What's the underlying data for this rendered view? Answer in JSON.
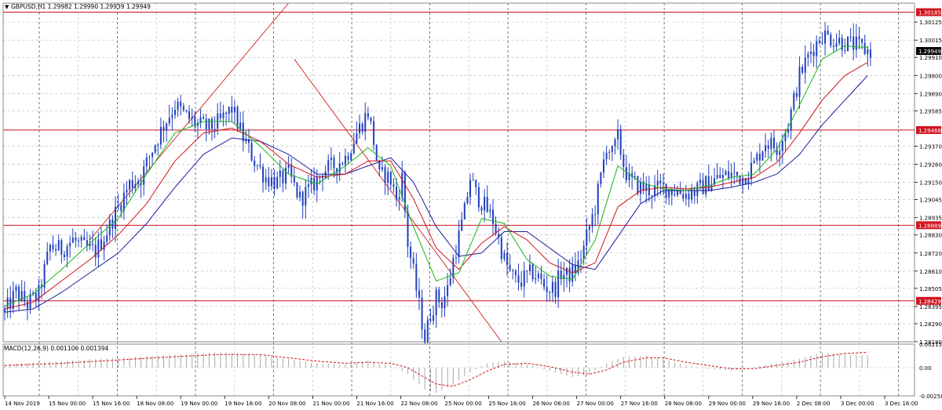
{
  "header": {
    "symbol_line": "GBPUSD,H1  1.29982 1.29990 1.29939 1.29949",
    "macd_label": "MACD(12,26,9) 0.001106 0.001394"
  },
  "colors": {
    "candle": "#1f3fbf",
    "ma_fast": "#17b817",
    "ma_mid": "#d0141e",
    "ma_slow": "#1c1c9c",
    "level_line": "#c8141e",
    "trend_line": "#d01c1c",
    "grid": "#b8b8b8",
    "macd_hist": "#a8a8a8",
    "macd_signal": "#d0141e",
    "price_tag_bg": "#000000",
    "level_tag_bg": "#d0141e"
  },
  "chart_data": [
    {
      "type": "candlestick",
      "symbol": "GBPUSD",
      "timeframe": "H1",
      "ohlc": {
        "open": 1.29982,
        "high": 1.2999,
        "low": 1.29939,
        "close": 1.29949
      },
      "current_price": "1.29949",
      "ylim": [
        1.2818,
        1.3024
      ],
      "y_ticks": [
        "1.30125",
        "1.30015",
        "1.29910",
        "1.29800",
        "1.29690",
        "1.29585",
        "1.29370",
        "1.29260",
        "1.29150",
        "1.29045",
        "1.28935",
        "1.28830",
        "1.28720",
        "1.28610",
        "1.28505",
        "1.28395",
        "1.28290",
        "1.28180"
      ],
      "x_ticks": [
        "14 Nov 2019",
        "15 Nov 00:00",
        "15 Nov 16:00",
        "18 Nov 08:00",
        "19 Nov 00:00",
        "19 Nov 16:00",
        "20 Nov 08:00",
        "21 Nov 00:00",
        "21 Nov 16:00",
        "22 Nov 08:00",
        "25 Nov 00:00",
        "25 Nov 16:00",
        "26 Nov 08:00",
        "27 Nov 00:00",
        "27 Nov 16:00",
        "28 Nov 08:00",
        "29 Nov 00:00",
        "29 Nov 16:00",
        "2 Dec 08:00",
        "3 Dec 00:00",
        "3 Dec 16:00"
      ],
      "horizontal_levels": [
        {
          "value": 1.30185,
          "label": "1.30185"
        },
        {
          "value": 1.29468,
          "label": "1.29468"
        },
        {
          "value": 1.28889,
          "label": "1.28889"
        },
        {
          "value": 1.28429,
          "label": "1.28429"
        }
      ],
      "close_path": [
        [
          0,
          1.2836
        ],
        [
          4,
          1.2848
        ],
        [
          8,
          1.2841
        ],
        [
          12,
          1.2847
        ],
        [
          16,
          1.2876
        ],
        [
          20,
          1.2874
        ],
        [
          24,
          1.288
        ],
        [
          28,
          1.2875
        ],
        [
          32,
          1.2873
        ],
        [
          36,
          1.2885
        ],
        [
          40,
          1.29
        ],
        [
          44,
          1.2914
        ],
        [
          48,
          1.2918
        ],
        [
          52,
          1.2935
        ],
        [
          56,
          1.295
        ],
        [
          60,
          1.2962
        ],
        [
          64,
          1.2955
        ],
        [
          68,
          1.295
        ],
        [
          72,
          1.2948
        ],
        [
          76,
          1.2952
        ],
        [
          80,
          1.296
        ],
        [
          84,
          1.2942
        ],
        [
          88,
          1.2928
        ],
        [
          92,
          1.2918
        ],
        [
          96,
          1.2915
        ],
        [
          100,
          1.292
        ],
        [
          104,
          1.2905
        ],
        [
          108,
          1.2912
        ],
        [
          112,
          1.2922
        ],
        [
          116,
          1.2925
        ],
        [
          120,
          1.293
        ],
        [
          124,
          1.2945
        ],
        [
          128,
          1.2958
        ],
        [
          130,
          1.294
        ],
        [
          132,
          1.2918
        ],
        [
          134,
          1.292
        ],
        [
          136,
          1.2916
        ],
        [
          138,
          1.2905
        ],
        [
          140,
          1.2918
        ],
        [
          142,
          1.2878
        ],
        [
          144,
          1.286
        ],
        [
          146,
          1.284
        ],
        [
          148,
          1.282
        ],
        [
          150,
          1.2835
        ],
        [
          152,
          1.2845
        ],
        [
          154,
          1.2842
        ],
        [
          156,
          1.285
        ],
        [
          158,
          1.2868
        ],
        [
          160,
          1.2882
        ],
        [
          162,
          1.2897
        ],
        [
          164,
          1.2918
        ],
        [
          166,
          1.2908
        ],
        [
          168,
          1.2903
        ],
        [
          170,
          1.2898
        ],
        [
          172,
          1.2892
        ],
        [
          174,
          1.288
        ],
        [
          176,
          1.2868
        ],
        [
          178,
          1.286
        ],
        [
          180,
          1.2855
        ],
        [
          182,
          1.2855
        ],
        [
          184,
          1.2858
        ],
        [
          186,
          1.286
        ],
        [
          188,
          1.2857
        ],
        [
          190,
          1.2852
        ],
        [
          192,
          1.285
        ],
        [
          194,
          1.2851
        ],
        [
          196,
          1.286
        ],
        [
          198,
          1.2858
        ],
        [
          200,
          1.286
        ],
        [
          202,
          1.2865
        ],
        [
          204,
          1.2875
        ],
        [
          206,
          1.2888
        ],
        [
          208,
          1.29
        ],
        [
          210,
          1.2918
        ],
        [
          212,
          1.2938
        ],
        [
          214,
          1.2932
        ],
        [
          216,
          1.2942
        ],
        [
          218,
          1.2926
        ],
        [
          220,
          1.2916
        ],
        [
          224,
          1.2912
        ],
        [
          228,
          1.291
        ],
        [
          232,
          1.2912
        ],
        [
          236,
          1.291
        ],
        [
          240,
          1.2908
        ],
        [
          244,
          1.291
        ],
        [
          248,
          1.2915
        ],
        [
          252,
          1.2918
        ],
        [
          256,
          1.292
        ],
        [
          260,
          1.2918
        ],
        [
          264,
          1.2926
        ],
        [
          268,
          1.294
        ],
        [
          272,
          1.2936
        ],
        [
          276,
          1.295
        ],
        [
          280,
          1.298
        ],
        [
          284,
          1.2995
        ],
        [
          288,
          1.3005
        ],
        [
          292,
          1.3002
        ],
        [
          296,
          1.3
        ],
        [
          300,
          1.2998
        ],
        [
          304,
          1.2995
        ]
      ],
      "ma_fast_path": [
        [
          0,
          1.284
        ],
        [
          10,
          1.2847
        ],
        [
          20,
          1.2862
        ],
        [
          30,
          1.2878
        ],
        [
          40,
          1.2893
        ],
        [
          50,
          1.292
        ],
        [
          60,
          1.2945
        ],
        [
          70,
          1.2952
        ],
        [
          80,
          1.2952
        ],
        [
          90,
          1.2937
        ],
        [
          100,
          1.292
        ],
        [
          110,
          1.2914
        ],
        [
          120,
          1.2925
        ],
        [
          128,
          1.2936
        ],
        [
          136,
          1.2925
        ],
        [
          144,
          1.2888
        ],
        [
          152,
          1.2855
        ],
        [
          160,
          1.286
        ],
        [
          168,
          1.2893
        ],
        [
          176,
          1.289
        ],
        [
          184,
          1.2868
        ],
        [
          192,
          1.2858
        ],
        [
          200,
          1.2856
        ],
        [
          208,
          1.288
        ],
        [
          216,
          1.2925
        ],
        [
          224,
          1.2915
        ],
        [
          232,
          1.2911
        ],
        [
          240,
          1.291
        ],
        [
          248,
          1.2913
        ],
        [
          256,
          1.2918
        ],
        [
          264,
          1.292
        ],
        [
          272,
          1.2935
        ],
        [
          280,
          1.2962
        ],
        [
          288,
          1.299
        ],
        [
          296,
          1.2998
        ],
        [
          304,
          1.2997
        ]
      ],
      "ma_mid_path": [
        [
          0,
          1.2838
        ],
        [
          10,
          1.2842
        ],
        [
          20,
          1.2855
        ],
        [
          30,
          1.2868
        ],
        [
          40,
          1.2883
        ],
        [
          50,
          1.2902
        ],
        [
          60,
          1.2928
        ],
        [
          70,
          1.2945
        ],
        [
          80,
          1.2948
        ],
        [
          90,
          1.294
        ],
        [
          100,
          1.2926
        ],
        [
          110,
          1.2918
        ],
        [
          120,
          1.292
        ],
        [
          128,
          1.2928
        ],
        [
          136,
          1.2928
        ],
        [
          144,
          1.2905
        ],
        [
          152,
          1.2875
        ],
        [
          160,
          1.2862
        ],
        [
          168,
          1.2878
        ],
        [
          176,
          1.2888
        ],
        [
          184,
          1.288
        ],
        [
          192,
          1.2866
        ],
        [
          200,
          1.286
        ],
        [
          208,
          1.2866
        ],
        [
          216,
          1.29
        ],
        [
          224,
          1.291
        ],
        [
          232,
          1.2912
        ],
        [
          240,
          1.2911
        ],
        [
          248,
          1.2912
        ],
        [
          256,
          1.2915
        ],
        [
          264,
          1.2918
        ],
        [
          272,
          1.2927
        ],
        [
          280,
          1.2945
        ],
        [
          288,
          1.2965
        ],
        [
          296,
          1.298
        ],
        [
          304,
          1.2988
        ]
      ],
      "ma_slow_path": [
        [
          0,
          1.2836
        ],
        [
          10,
          1.2838
        ],
        [
          20,
          1.2848
        ],
        [
          30,
          1.286
        ],
        [
          40,
          1.2872
        ],
        [
          50,
          1.289
        ],
        [
          60,
          1.2912
        ],
        [
          70,
          1.2932
        ],
        [
          80,
          1.2942
        ],
        [
          90,
          1.294
        ],
        [
          100,
          1.2932
        ],
        [
          110,
          1.292
        ],
        [
          120,
          1.292
        ],
        [
          128,
          1.2925
        ],
        [
          136,
          1.293
        ],
        [
          144,
          1.2915
        ],
        [
          152,
          1.2888
        ],
        [
          160,
          1.287
        ],
        [
          168,
          1.2872
        ],
        [
          176,
          1.2885
        ],
        [
          184,
          1.2885
        ],
        [
          192,
          1.2875
        ],
        [
          200,
          1.2865
        ],
        [
          208,
          1.2862
        ],
        [
          216,
          1.2882
        ],
        [
          224,
          1.2902
        ],
        [
          232,
          1.291
        ],
        [
          240,
          1.291
        ],
        [
          248,
          1.291
        ],
        [
          256,
          1.2912
        ],
        [
          264,
          1.2915
        ],
        [
          272,
          1.292
        ],
        [
          280,
          1.2932
        ],
        [
          288,
          1.295
        ],
        [
          296,
          1.2965
        ],
        [
          304,
          1.298
        ]
      ]
    },
    {
      "type": "histogram",
      "indicator": "MACD(12,26,9)",
      "value": "0.001106",
      "signal_value": "0.001394",
      "ylim": [
        -0.00258,
        0.00215
      ],
      "y_ticks": [
        "0.002159",
        "0.00",
        "-0.002581"
      ],
      "hist_path": [
        [
          0,
          0.0003
        ],
        [
          20,
          0.0006
        ],
        [
          40,
          0.0009
        ],
        [
          60,
          0.0012
        ],
        [
          75,
          0.0014
        ],
        [
          90,
          0.0012
        ],
        [
          100,
          0.0008
        ],
        [
          110,
          0.0004
        ],
        [
          120,
          0.0003
        ],
        [
          128,
          0.0006
        ],
        [
          136,
          0.0002
        ],
        [
          142,
          -0.0006
        ],
        [
          148,
          -0.002
        ],
        [
          152,
          -0.0023
        ],
        [
          158,
          -0.0016
        ],
        [
          164,
          -0.0004
        ],
        [
          170,
          0.0004
        ],
        [
          176,
          0.0006
        ],
        [
          184,
          0.0003
        ],
        [
          192,
          -0.0003
        ],
        [
          200,
          -0.0009
        ],
        [
          206,
          -0.0006
        ],
        [
          212,
          0.0004
        ],
        [
          218,
          0.001
        ],
        [
          226,
          0.0011
        ],
        [
          232,
          0.0008
        ],
        [
          240,
          0.0002
        ],
        [
          248,
          -0.0001
        ],
        [
          256,
          -0.0003
        ],
        [
          264,
          0.0001
        ],
        [
          272,
          0.0004
        ],
        [
          280,
          0.0008
        ],
        [
          288,
          0.0014
        ],
        [
          296,
          0.0012
        ],
        [
          304,
          0.0011
        ]
      ],
      "signal_path": [
        [
          0,
          0.0002
        ],
        [
          20,
          0.0004
        ],
        [
          40,
          0.0007
        ],
        [
          60,
          0.001
        ],
        [
          75,
          0.0012
        ],
        [
          90,
          0.0012
        ],
        [
          100,
          0.0009
        ],
        [
          110,
          0.0006
        ],
        [
          120,
          0.0004
        ],
        [
          128,
          0.0005
        ],
        [
          136,
          0.0004
        ],
        [
          142,
          0.0
        ],
        [
          148,
          -0.0009
        ],
        [
          152,
          -0.0015
        ],
        [
          158,
          -0.0017
        ],
        [
          164,
          -0.0011
        ],
        [
          170,
          -0.0003
        ],
        [
          176,
          0.0003
        ],
        [
          184,
          0.0004
        ],
        [
          192,
          0.0001
        ],
        [
          200,
          -0.0004
        ],
        [
          206,
          -0.0006
        ],
        [
          212,
          -0.0002
        ],
        [
          218,
          0.0005
        ],
        [
          226,
          0.0009
        ],
        [
          232,
          0.0009
        ],
        [
          240,
          0.0005
        ],
        [
          248,
          0.0002
        ],
        [
          256,
          -0.0001
        ],
        [
          264,
          -0.0001
        ],
        [
          272,
          0.0002
        ],
        [
          280,
          0.0005
        ],
        [
          288,
          0.001
        ],
        [
          296,
          0.0013
        ],
        [
          304,
          0.0014
        ]
      ]
    }
  ]
}
